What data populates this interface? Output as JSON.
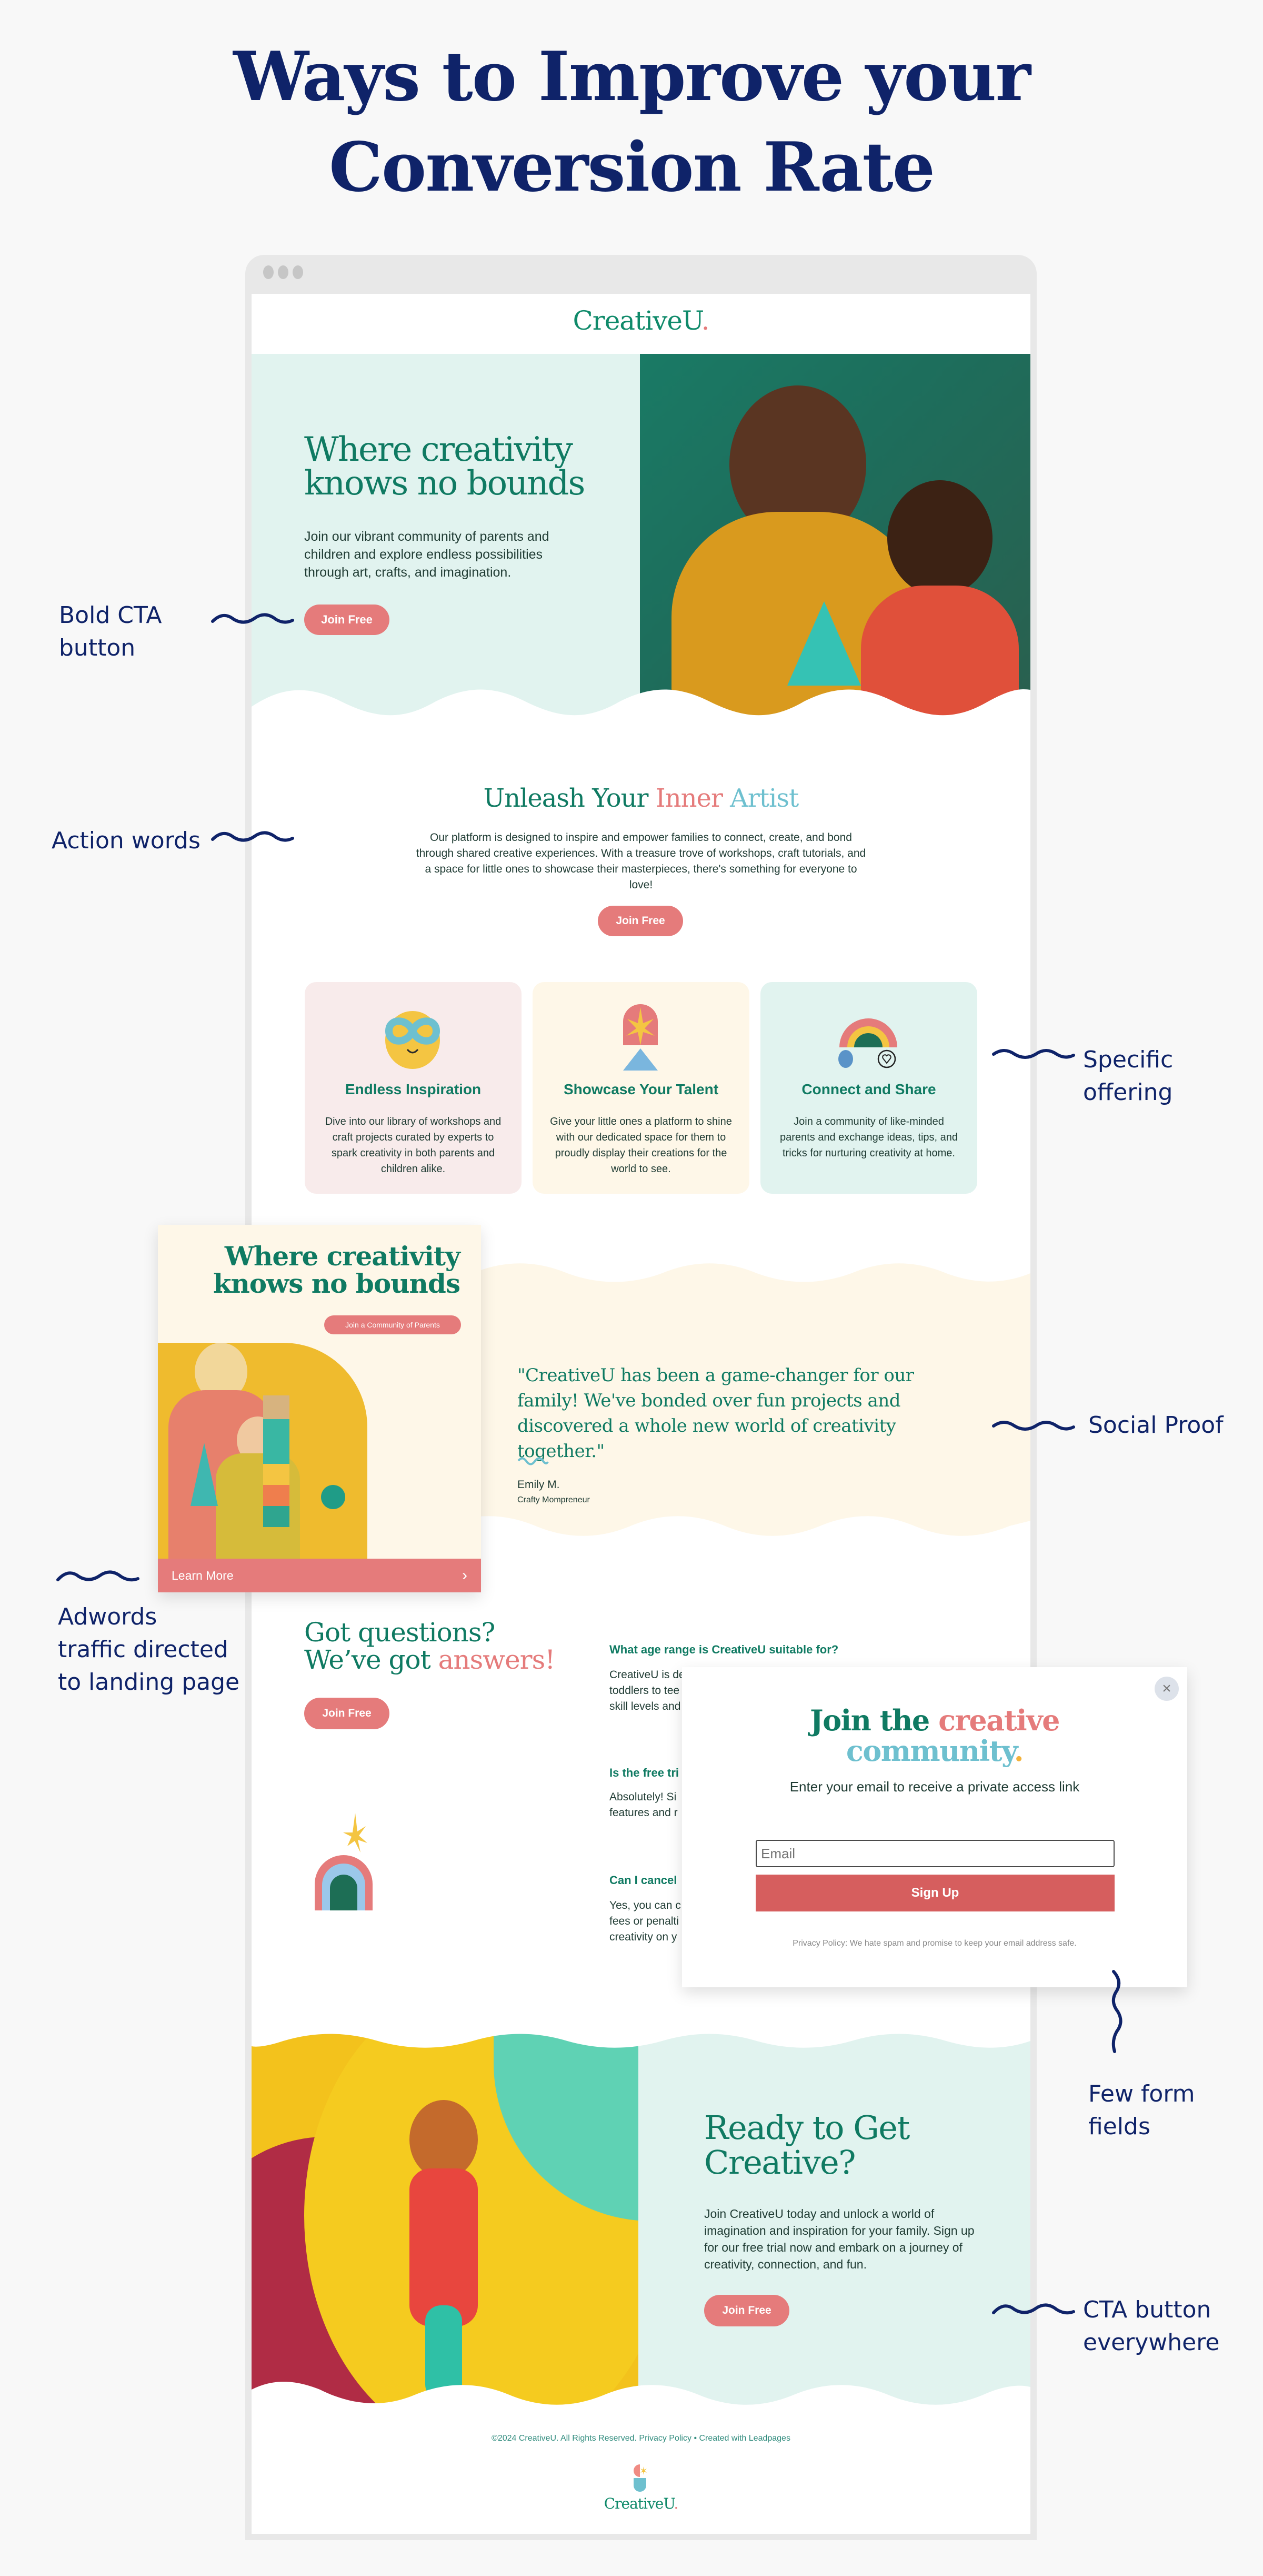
{
  "infographic": {
    "title_line1": "Ways to Improve your",
    "title_line2": "Conversion Rate"
  },
  "annotations": [
    {
      "id": "bold-cta",
      "line1": "Bold CTA",
      "line2": "button"
    },
    {
      "id": "action-words",
      "line1": "Action words",
      "line2": ""
    },
    {
      "id": "specific-offering",
      "line1": "Specific",
      "line2": "offering"
    },
    {
      "id": "social-proof",
      "line1": "Social Proof",
      "line2": ""
    },
    {
      "id": "adwords",
      "line1": "Adwords",
      "line2": "traffic directed",
      "line3": "to landing page"
    },
    {
      "id": "few-form-fields",
      "line1": "Few form",
      "line2": "fields"
    },
    {
      "id": "cta-everywhere",
      "line1": "CTA button",
      "line2": "everywhere"
    }
  ],
  "site": {
    "logo": "CreativeU",
    "logo_dot": ".",
    "hero": {
      "title_line1": "Where creativity",
      "title_line2": "knows no bounds",
      "body": "Join our vibrant community of parents and children and explore endless possibilities through art, crafts, and imagination.",
      "cta": "Join Free"
    },
    "intro": {
      "title_part1": "Unleash Your ",
      "title_part2": "Inner ",
      "title_part3": "Artist",
      "body": "Our platform is designed to inspire and empower families to connect, create, and bond through shared creative experiences. With a treasure trove of workshops, craft tutorials, and a space for little ones to showcase their masterpieces, there's something for everyone to love!",
      "cta": "Join Free"
    },
    "features": [
      {
        "icon": "infinity-face-icon",
        "title": "Endless Inspiration",
        "body": "Dive into our library of workshops and craft projects curated by experts to spark creativity in both parents and children alike.",
        "bg": "#f8ebeb"
      },
      {
        "icon": "star-arch-icon",
        "title": "Showcase Your Talent",
        "body": "Give your little ones a platform to shine with our dedicated space for them to proudly display their creations for the world to see.",
        "bg": "#fef7e8"
      },
      {
        "icon": "rainbow-heart-icon",
        "title": "Connect and Share",
        "body": "Join a community of like-minded parents and exchange ideas, tips, and tricks for nurturing creativity at home.",
        "bg": "#e1f3ef"
      }
    ],
    "ad": {
      "title_line1": "Where creativity",
      "title_line2": "knows no bounds",
      "pill": "Join a Community of Parents",
      "cta": "Learn More"
    },
    "testimonial": {
      "quote": "\"CreativeU has been a game-changer for our family! We've bonded over fun projects and discovered a whole new world of creativity together.\"",
      "name": "Emily M.",
      "role": "Crafty Mompreneur"
    },
    "faq": {
      "title_line1": "Got questions?",
      "title_line2a": "We’ve got ",
      "title_line2b": "answers!",
      "cta": "Join Free",
      "items": [
        {
          "q": "What age range is CreativeU suitable for?",
          "a_lines": [
            "CreativeU is de",
            "toddlers to tee",
            "skill levels and"
          ]
        },
        {
          "q": "Is the free tri",
          "a_lines": [
            "Absolutely! Si",
            "features and r"
          ]
        },
        {
          "q": "Can I cancel",
          "a_lines": [
            "Yes, you can c",
            "fees or penalti",
            "creativity on y"
          ]
        }
      ]
    },
    "popup": {
      "title_part1": "Join the ",
      "title_part2": "creative",
      "title_part3": "community",
      "title_dot": ".",
      "subtitle": "Enter your email to receive a private access link",
      "email_placeholder": "Email",
      "submit": "Sign Up",
      "privacy": "Privacy Policy: We hate spam and promise to keep your email address safe.",
      "close": "×"
    },
    "final_cta": {
      "title_line1": "Ready to Get",
      "title_line2": "Creative?",
      "body": "Join CreativeU today and unlock a world of imagination and inspiration for your family. Sign up for our free trial now and embark on a journey of creativity, connection, and fun.",
      "cta": "Join Free"
    },
    "footer": {
      "copyright": "©2024 CreativeU. All Rights Reserved.",
      "privacy_link": "Privacy Policy",
      "separator": "•",
      "credit": "Created with Leadpages",
      "logo": "CreativeU"
    }
  },
  "colors": {
    "navy": "#0f2369",
    "brand_green": "#0f7a62",
    "coral": "#e57b7b",
    "teal": "#6ec0cf",
    "mint_bg": "#e1f3ef",
    "cream_bg": "#fef7e8",
    "pink_bg": "#f8ebeb"
  }
}
